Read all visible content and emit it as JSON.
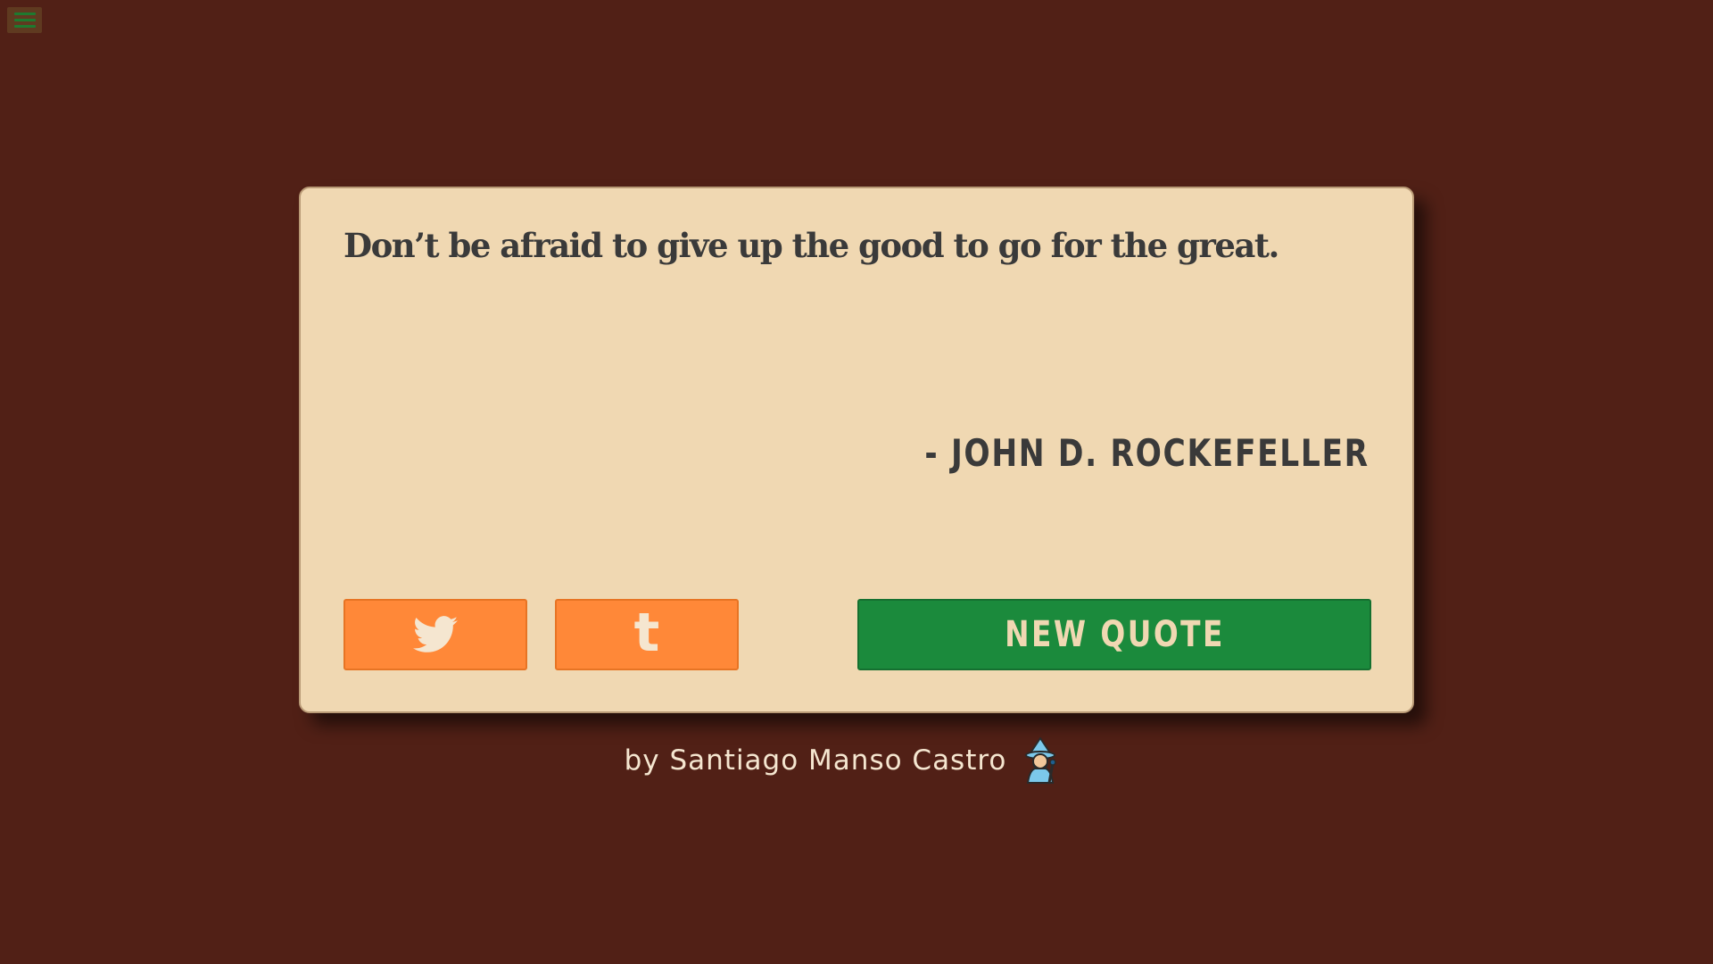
{
  "menu": {
    "icon": "hamburger-icon"
  },
  "quote": {
    "text": "Don’t be afraid to give up the good to go for the great.",
    "author": "- JOHN D. ROCKEFELLER"
  },
  "share": {
    "twitter_icon": "twitter-icon",
    "tumblr_icon": "tumblr-icon",
    "tumblr_glyph": "t"
  },
  "actions": {
    "new_quote_label": "NEW QUOTE"
  },
  "footer": {
    "credit": "by Santiago Manso Castro",
    "emoji_icon": "mage-icon"
  },
  "colors": {
    "background": "#512016",
    "card": "#f0d8b2",
    "share_button": "#ff8838",
    "new_quote_button": "#1b8a3c",
    "text_dark": "#3a3a3a"
  }
}
